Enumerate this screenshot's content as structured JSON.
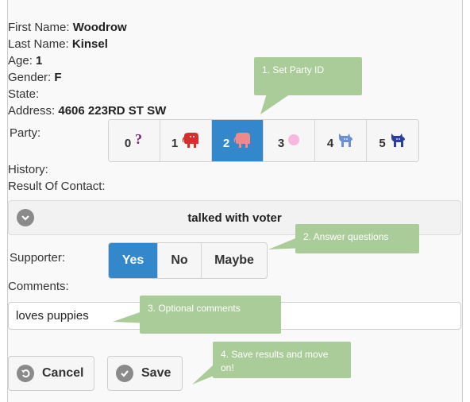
{
  "voter": {
    "first_name_label": "First Name:",
    "first_name": "Woodrow",
    "last_name_label": "Last Name:",
    "last_name": "Kinsel",
    "age_label": "Age:",
    "age": "1",
    "gender_label": "Gender:",
    "gender": "F",
    "state_label": "State:",
    "state": "",
    "address_label": "Address:",
    "address": "4606 223RD ST SW"
  },
  "party": {
    "label": "Party:",
    "options": [
      {
        "num": "0",
        "icon": "question-mark-icon"
      },
      {
        "num": "1",
        "icon": "elephant-icon"
      },
      {
        "num": "2",
        "icon": "elephant-icon",
        "selected": true
      },
      {
        "num": "3",
        "icon": "pink-circle-icon"
      },
      {
        "num": "4",
        "icon": "donkey-icon"
      },
      {
        "num": "5",
        "icon": "donkey-icon"
      }
    ]
  },
  "history_label": "History:",
  "result_label": "Result Of Contact:",
  "collapsible": {
    "title": "talked with voter",
    "icon": "chevron-down-icon"
  },
  "supporter": {
    "label": "Supporter:",
    "options": [
      "Yes",
      "No",
      "Maybe"
    ],
    "selected": "Yes"
  },
  "comments": {
    "label": "Comments:",
    "value": "loves puppies"
  },
  "buttons": {
    "cancel": "Cancel",
    "save": "Save"
  },
  "callouts": {
    "c1": "1. Set Party ID",
    "c2": "2. Answer questions",
    "c3": "3. Optional comments",
    "c4": "4. Save results and move on!"
  },
  "colors": {
    "accent": "#3388cc",
    "callout": "#aacc99",
    "republican_red": "#e03a3a",
    "democrat_blue": "#2b3e9e",
    "pink": "#f7b8e0"
  }
}
